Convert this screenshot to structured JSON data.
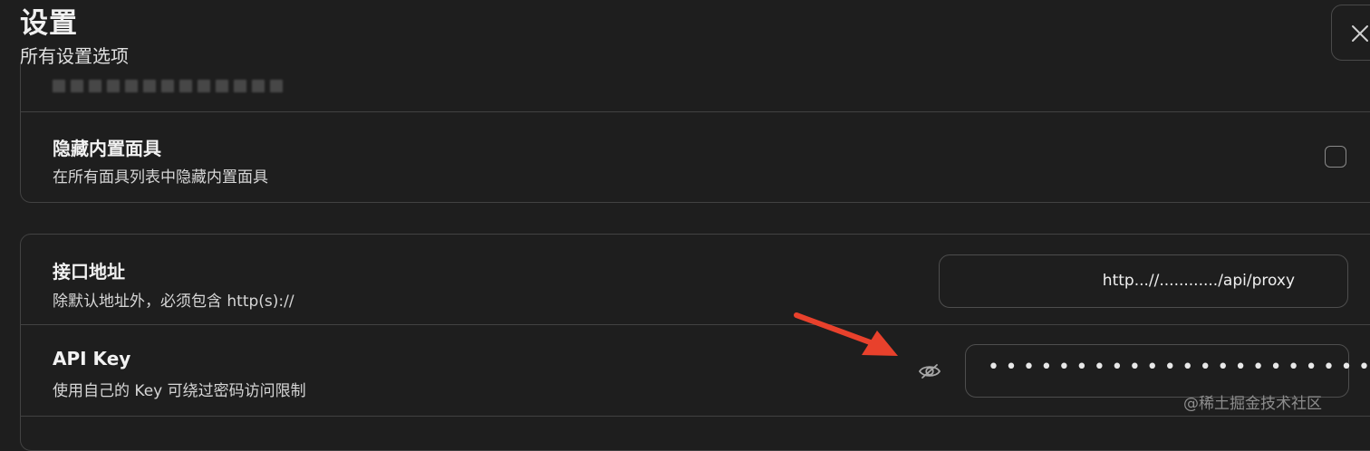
{
  "header": {
    "title": "设置",
    "subtitle": "所有设置选项"
  },
  "settings": {
    "hide_masks": {
      "title": "隐藏内置面具",
      "description": "在所有面具列表中隐藏内置面具",
      "checked": false
    },
    "endpoint": {
      "title": "接口地址",
      "description": "除默认地址外，必须包含 http(s)://",
      "value": "http...//............/api/proxy"
    },
    "api_key": {
      "title": "API Key",
      "description": "使用自己的 Key 可绕过密码访问限制",
      "value_masked": "••••••••••••••••••••••"
    }
  },
  "icons": {
    "close": "close-icon",
    "eye": "eye-off-icon",
    "annotation": "red-arrow"
  },
  "colors": {
    "background": "#1e1e1e",
    "border": "#424242",
    "arrow": "#e8412c"
  },
  "watermark": "@稀土掘金技术社区"
}
